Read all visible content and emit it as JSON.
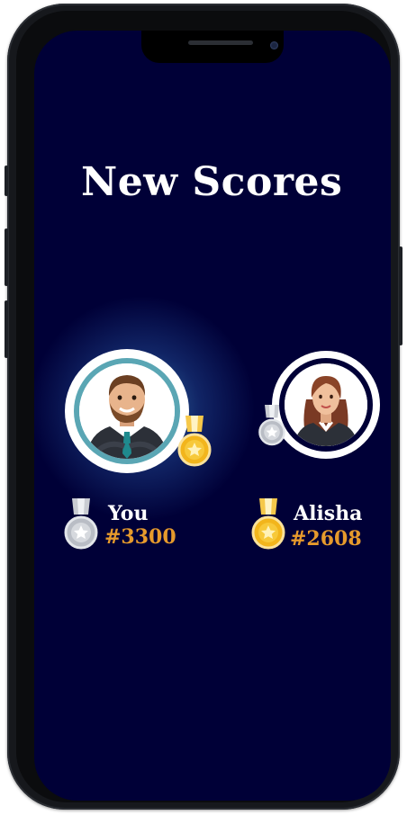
{
  "screen": {
    "title": "New Scores",
    "background": "#000037"
  },
  "players": [
    {
      "name": "You",
      "score": "#3300",
      "medal": "silver-medal-icon",
      "badge": "gold-medal-icon",
      "highlighted": true
    },
    {
      "name": "Alisha",
      "score": "#2608",
      "medal": "gold-medal-icon",
      "badge": "silver-medal-icon",
      "highlighted": false
    }
  ],
  "colors": {
    "score": "#e69a2c",
    "ring_accent": "#5aa6b4",
    "gold": "#f2b51c",
    "silver": "#c9ccd2"
  }
}
